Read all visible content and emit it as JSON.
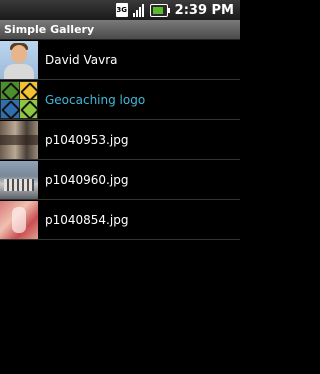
{
  "status_bar": {
    "network_label": "3G",
    "time": "2:39",
    "time_suffix": "PM"
  },
  "app": {
    "title": "Simple Gallery"
  },
  "items": [
    {
      "label": "David Vavra",
      "thumb": "person",
      "highlighted": false
    },
    {
      "label": "Geocaching logo",
      "thumb": "geocache",
      "highlighted": true
    },
    {
      "label": "p1040953.jpg",
      "thumb": "photo",
      "highlighted": false
    },
    {
      "label": "p1040960.jpg",
      "thumb": "photo",
      "highlighted": false
    },
    {
      "label": "p1040854.jpg",
      "thumb": "photo",
      "highlighted": false
    }
  ],
  "colors": {
    "highlight_text": "#3fb8d8",
    "background": "#000000"
  }
}
